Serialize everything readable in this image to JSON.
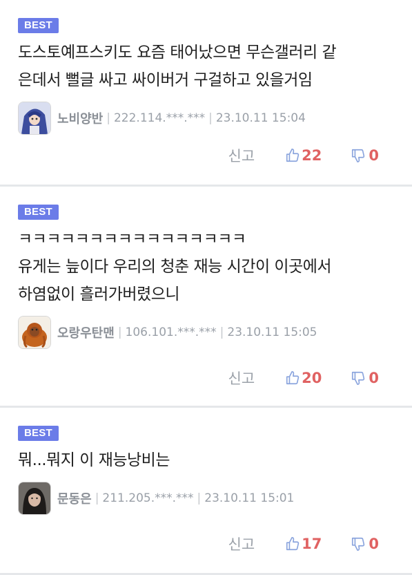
{
  "colors": {
    "best_badge": "#6b7ce8",
    "vote_count": "#e06262",
    "thumb_icon": "#8aa4dd"
  },
  "comments": [
    {
      "badge": "BEST",
      "text": "도스토예프스키도 요즘 태어났으면 무슨갤러리 같\n은데서 뻘글 싸고 싸이버거 구걸하고 있을거임",
      "author": "노비양반",
      "ip": "222.114.***.***",
      "date": "23.10.11 15:04",
      "report": "신고",
      "upvotes": "22",
      "downvotes": "0",
      "avatar_icon": "anime-character-avatar-icon"
    },
    {
      "badge": "BEST",
      "text": "ㅋㅋㅋㅋㅋㅋㅋㅋㅋㅋㅋㅋㅋㅋㅋㅋ\n유게는 늪이다 우리의 청춘 재능 시간이 이곳에서\n하염없이 흘러가버렸으니",
      "author": "오랑우탄맨",
      "ip": "106.101.***.***",
      "date": "23.10.11 15:05",
      "report": "신고",
      "upvotes": "20",
      "downvotes": "0",
      "avatar_icon": "orangutan-avatar-icon"
    },
    {
      "badge": "BEST",
      "text": "뭐...뭐지 이 재능낭비는",
      "author": "문동은",
      "ip": "211.205.***.***",
      "date": "23.10.11 15:01",
      "report": "신고",
      "upvotes": "17",
      "downvotes": "0",
      "avatar_icon": "person-photo-avatar-icon"
    }
  ]
}
